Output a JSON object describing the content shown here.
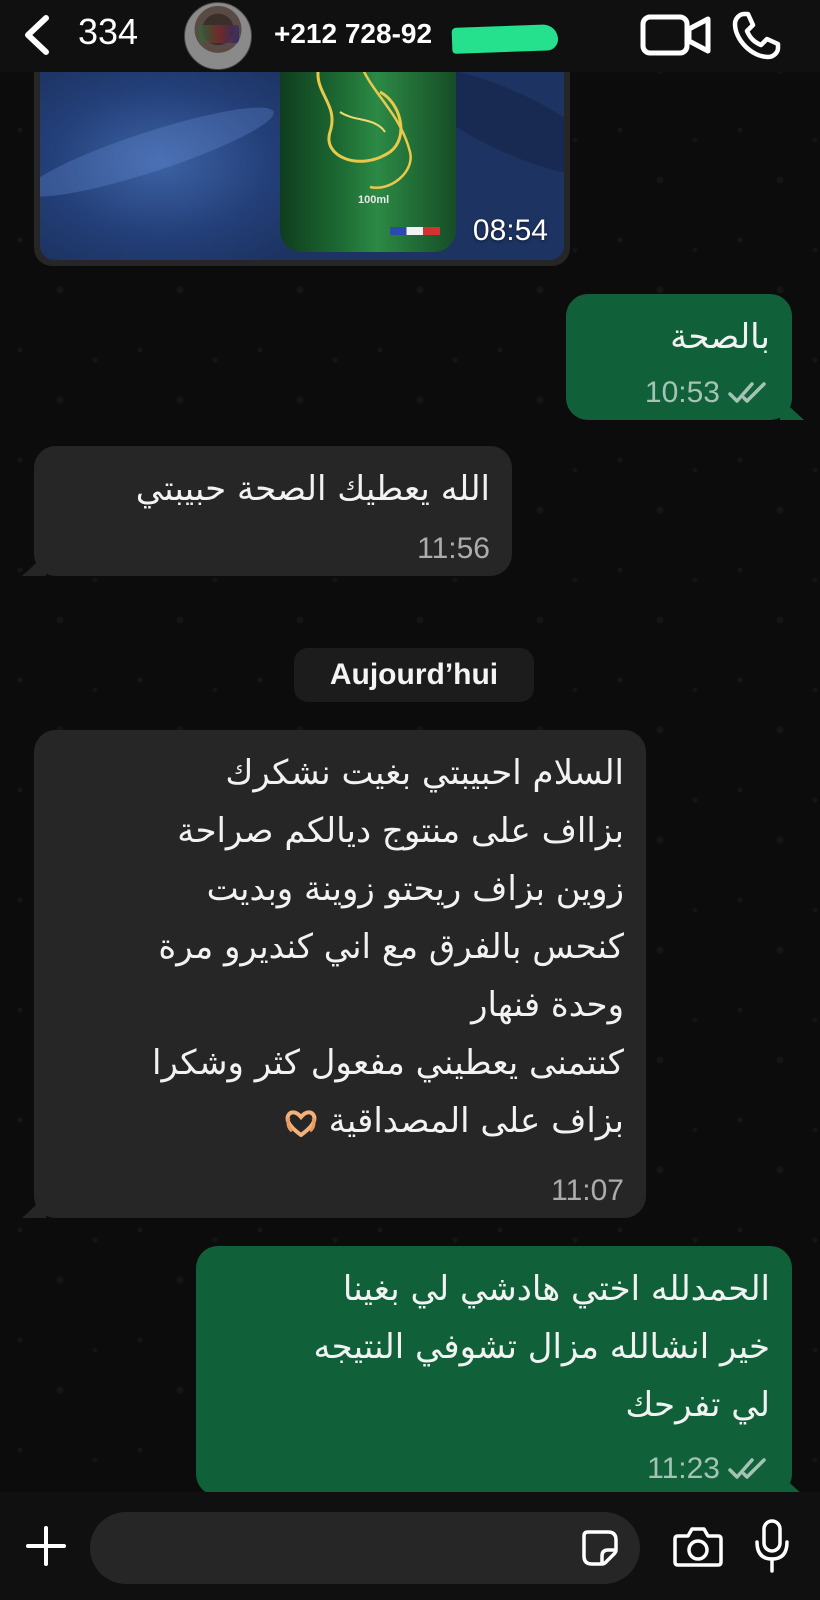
{
  "header": {
    "back_count": "334",
    "contact_phone": "+212 728-92",
    "icons": [
      "back-chevron-icon",
      "avatar",
      "video-call-icon",
      "voice-call-icon"
    ]
  },
  "messages": {
    "image": {
      "time": "08:54",
      "product_label": "100ml"
    },
    "m1": {
      "text": "بالصحة",
      "time": "10:53",
      "direction": "outgoing",
      "status": "read"
    },
    "m2": {
      "text": "الله يعطيك الصحة حبيبتي",
      "time": "11:56",
      "direction": "incoming"
    },
    "date_separator": "Aujourd’hui",
    "m3": {
      "lines": [
        "السلام احبيبتي بغيت نشكرك",
        "بزااف على منتوج ديالكم صراحة",
        "زوين بزاف ريحتو زوينة وبديت",
        "كنحس بالفرق مع اني كنديرو مرة",
        "وحدة فنهار",
        "كنتمنى يعطيني مفعول كثر وشكرا",
        "بزاف على المصداقية"
      ],
      "emoji": "heart-hands-emoji",
      "time": "11:07",
      "direction": "incoming"
    },
    "m4": {
      "lines": [
        "الحمدلله اختي هادشي لي بغينا",
        "خير انشالله مزال تشوفي النتيجه",
        "لي تفرحك"
      ],
      "time": "11:23",
      "direction": "outgoing",
      "status": "read"
    }
  },
  "composer": {
    "placeholder": "",
    "icons": [
      "plus-icon",
      "sticker-icon",
      "camera-icon",
      "microphone-icon"
    ]
  },
  "colors": {
    "incoming_bubble": "#262626",
    "outgoing_bubble": "#10613a",
    "background": "#0c0c0c",
    "header": "#101010"
  }
}
